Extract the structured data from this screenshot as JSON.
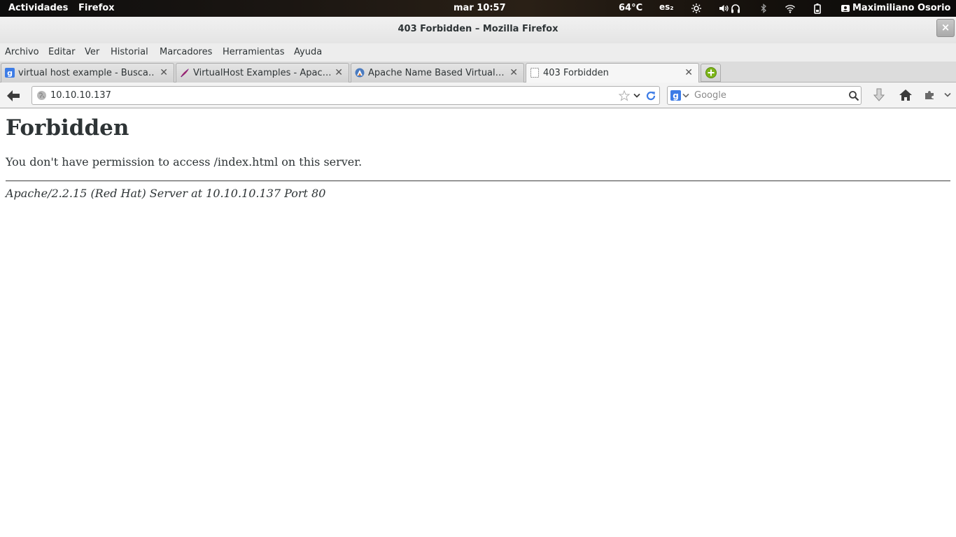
{
  "topbar": {
    "activities": "Actividades",
    "app_menu": "Firefox",
    "clock": "mar 10:57",
    "temperature": "64°C",
    "keyboard_layout": "es₂",
    "user_name": "Maximiliano Osorio"
  },
  "window": {
    "title": "403 Forbidden – Mozilla Firefox"
  },
  "menubar": {
    "items": [
      "Archivo",
      "Editar",
      "Ver",
      "Historial",
      "Marcadores",
      "Herramientas",
      "Ayuda"
    ]
  },
  "tabs": [
    {
      "label": "virtual host example - Busca…",
      "favicon": "google-icon",
      "active": false
    },
    {
      "label": "VirtualHost Examples - Apac…",
      "favicon": "apache-feather-icon",
      "active": false
    },
    {
      "label": "Apache Name Based Virtual…",
      "favicon": "site-icon",
      "active": false
    },
    {
      "label": "403 Forbidden",
      "favicon": "blank-page-icon",
      "active": true
    }
  ],
  "navbar": {
    "url": "10.10.10.137",
    "search_placeholder": "Google",
    "search_engine": "google-icon"
  },
  "page": {
    "heading": "Forbidden",
    "message": "You don't have permission to access /index.html on this server.",
    "address": "Apache/2.2.15 (Red Hat) Server at 10.10.10.137 Port 80"
  },
  "colors": {
    "text": "#2e3436",
    "topbar_bg": "#1b1612",
    "new_tab_green": "#7cb518",
    "google_blue": "#3d7ce6"
  }
}
